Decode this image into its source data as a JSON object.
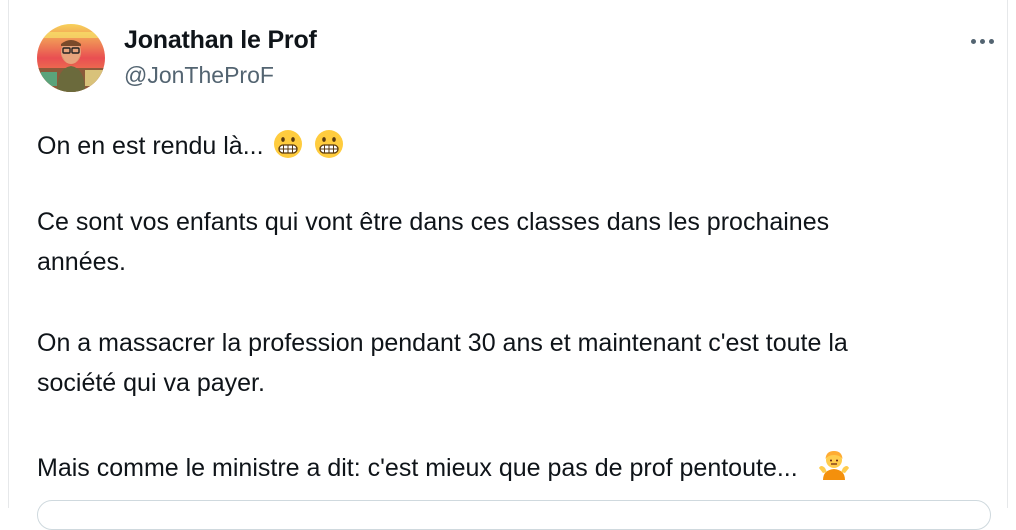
{
  "author": {
    "name": "Jonathan le Prof",
    "handle": "@JonTheProF",
    "avatar_icon": "profile-photo-icon"
  },
  "menu": {
    "icon": "more-options-icon"
  },
  "tweet": {
    "line1": "On en est rendu là...",
    "line1_emojis": [
      "grimacing-face-emoji",
      "grimacing-face-emoji"
    ],
    "para2_line1": "Ce sont vos enfants qui vont être dans ces classes dans les prochaines",
    "para2_line2": "années.",
    "para3_line1": "On a massacrer la profession pendant 30 ans et maintenant c'est toute la",
    "para3_line2": "société qui va payer.",
    "para4_line1": "Mais comme le ministre a dit: c'est mieux que pas de prof pentoute...",
    "para4_emoji": "person-shrugging-emoji"
  },
  "colors": {
    "text": "#0f1419",
    "secondary": "#536471",
    "emoji_yellow": "#ffcc3e",
    "shrug_orange": "#f4900c"
  }
}
